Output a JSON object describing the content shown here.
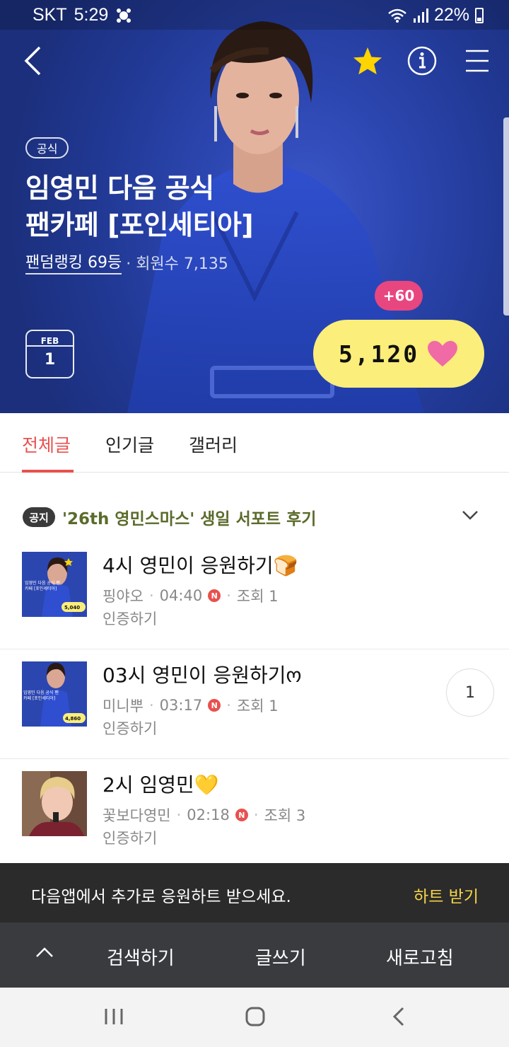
{
  "status_bar": {
    "carrier": "SKT",
    "time": "5:29",
    "battery": "22%"
  },
  "hero": {
    "badge": "공식",
    "title_line1": "임영민 다음 공식",
    "title_line2": "팬카페 [포인세티아]",
    "rank": "팬덤랭킹 69등",
    "members": "· 회원수 7,135",
    "date_month": "FEB",
    "date_day": "1",
    "heart_bonus": "+60",
    "heart_count": "5,120",
    "colors": {
      "bonus_pink": "#e8467f",
      "heart_yellow": "#fbee7a",
      "heart": "#f06aa6"
    }
  },
  "tabs": [
    {
      "label": "전체글",
      "active": true
    },
    {
      "label": "인기글",
      "active": false
    },
    {
      "label": "갤러리",
      "active": false
    }
  ],
  "notice": {
    "tag": "공지",
    "text": "'26th 영민스마스' 생일 서포트 후기"
  },
  "posts": [
    {
      "title": "4시 영민이 응원하기🍞",
      "author": "핑야오",
      "time": "04:40",
      "new": "N",
      "views": "조회 1",
      "sub": "인증하기",
      "comments": ""
    },
    {
      "title": "03시 영민이 응원하기ო",
      "author": "미니뿌",
      "time": "03:17",
      "new": "N",
      "views": "조회 1",
      "sub": "인증하기",
      "comments": "1"
    },
    {
      "title": "2시 임영민💛",
      "author": "꽃보다영민",
      "time": "02:18",
      "new": "N",
      "views": "조회 3",
      "sub": "인증하기",
      "comments": ""
    }
  ],
  "thumb_text": {
    "title_line1": "임영민 다음 공식 팬",
    "title_line2": "카페 [포인세티아]",
    "count_1": "5,040",
    "count_2": "4,860"
  },
  "banner": {
    "text": "다음앱에서 추가로 응원하트 받으세요.",
    "link": "하트 받기"
  },
  "bottom_bar": {
    "search": "검색하기",
    "write": "글쓰기",
    "refresh": "새로고침"
  },
  "accent_color": "#e8514e"
}
